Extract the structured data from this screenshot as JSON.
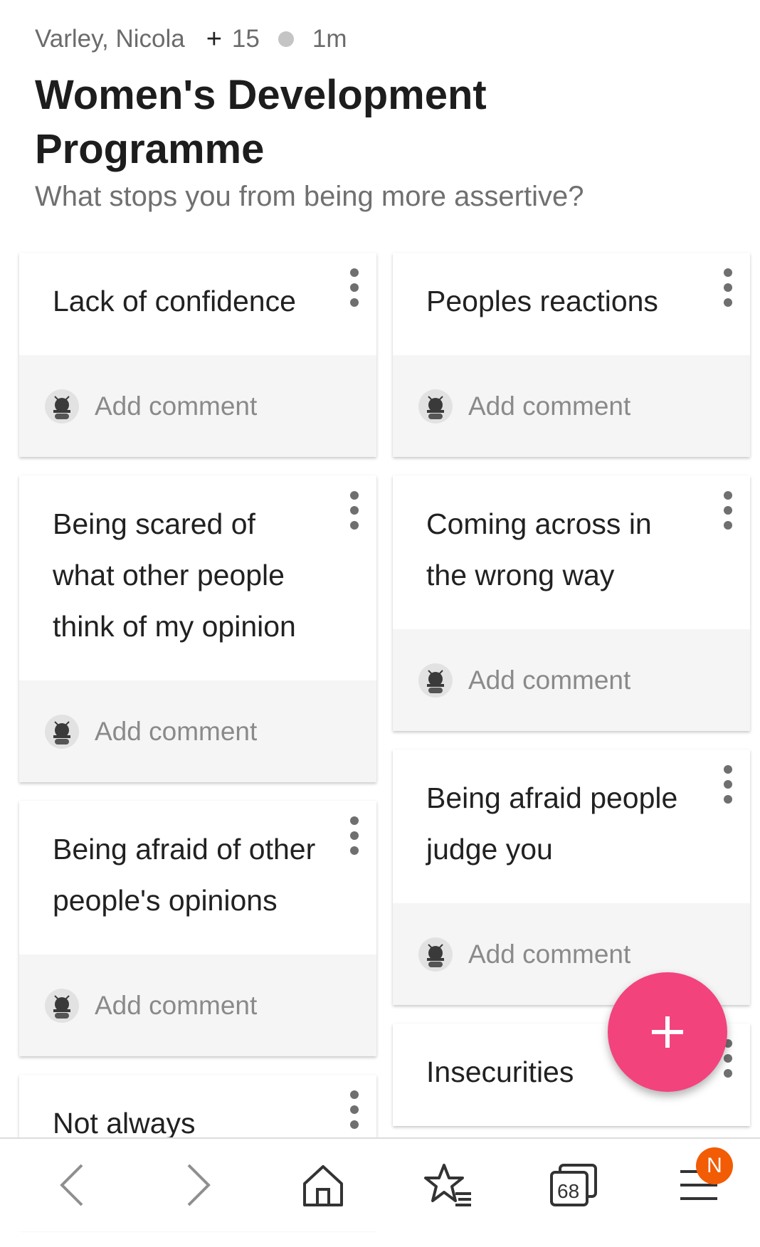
{
  "header": {
    "author": "Varley, Nicola",
    "plus": "+",
    "participants": "15",
    "time": "1m",
    "title": "Women's Development Programme",
    "subtitle": "What stops you from being more assertive?"
  },
  "cards": {
    "left": [
      {
        "text": "Lack of confidence",
        "comment_placeholder": "Add comment"
      },
      {
        "text": "Being scared of what other people think of my opinion",
        "comment_placeholder": "Add comment"
      },
      {
        "text": "Being afraid of other people's opinions",
        "comment_placeholder": "Add comment"
      },
      {
        "text": "Not always confident,",
        "comment_placeholder": ""
      }
    ],
    "right": [
      {
        "text": "Peoples reactions",
        "comment_placeholder": "Add comment"
      },
      {
        "text": "Coming across in the wrong way",
        "comment_placeholder": "Add comment"
      },
      {
        "text": "Being afraid people judge you",
        "comment_placeholder": "Add comment"
      },
      {
        "text": "Insecurities",
        "comment_placeholder": ""
      }
    ]
  },
  "fab": {
    "icon": "plus-icon"
  },
  "bottom_nav": {
    "items": [
      "back-icon",
      "forward-icon",
      "home-icon",
      "favorites-icon",
      "tabs-icon",
      "menu-icon"
    ],
    "tabs_count": "68",
    "menu_badge": "N"
  },
  "colors": {
    "fab": "#f2437d",
    "badge": "#f25c05"
  }
}
